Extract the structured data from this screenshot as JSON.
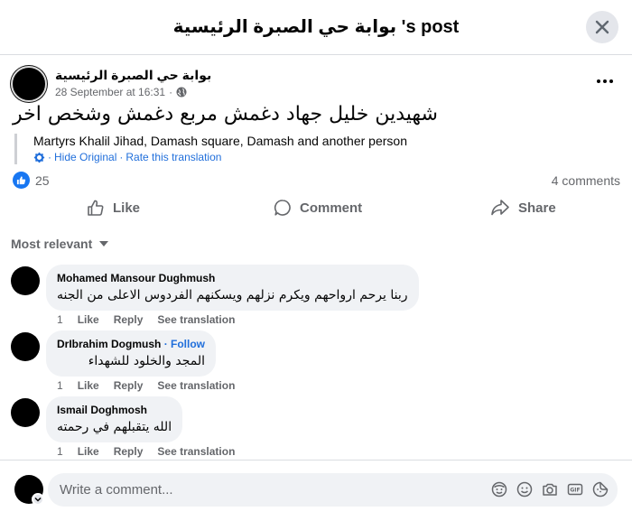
{
  "dialog": {
    "title": "بوابة حي الصبرة الرئيسية 's post"
  },
  "post": {
    "author": "بوابة حي الصبرة الرئيسية",
    "timestamp": "28 September at 16:31",
    "separator": "·",
    "text": "شهيدين خليل جهاد دغمش مربع دغمش وشخص اخر",
    "translation": "Martyrs Khalil Jihad, Damash square, Damash and another person",
    "hide_original": "Hide Original",
    "rate_translation": "Rate this translation",
    "link_separator": "·",
    "reaction_count": "25",
    "comment_count": "4 comments"
  },
  "actions": {
    "like": "Like",
    "comment": "Comment",
    "share": "Share"
  },
  "sort": {
    "label": "Most relevant"
  },
  "comments": [
    {
      "author": "Mohamed Mansour Dughmush",
      "text": "ربنا يرحم ارواحهم ويكرم نزلهم ويسكنهم الفردوس الاعلى من الجنه",
      "age": "1",
      "like": "Like",
      "reply": "Reply",
      "see_translation": "See translation"
    },
    {
      "author": "DrIbrahim Dogmush",
      "follow": "· Follow",
      "text": "المجد والخلود للشهداء",
      "age": "1",
      "like": "Like",
      "reply": "Reply",
      "see_translation": "See translation"
    },
    {
      "author": "Ismail Doghmosh",
      "text": "الله يتقبلهم في رحمته",
      "age": "1",
      "like": "Like",
      "reply": "Reply",
      "see_translation": "See translation"
    }
  ],
  "composer": {
    "placeholder": "Write a comment...",
    "icons": [
      "avatar-sticker-icon",
      "emoji-icon",
      "camera-icon",
      "gif-icon",
      "sticker-icon"
    ]
  },
  "colors": {
    "accent": "#1877f2",
    "link": "#216fdb",
    "secondary_text": "#65676b",
    "bubble": "#f0f2f5"
  }
}
